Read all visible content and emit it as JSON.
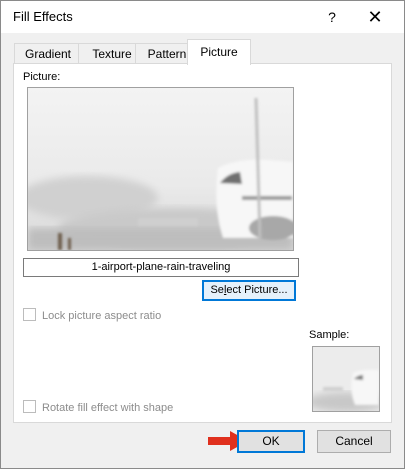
{
  "window": {
    "title": "Fill Effects",
    "help_label": "?",
    "close_label": "✕"
  },
  "tabs": [
    {
      "label": "Gradient",
      "active": false
    },
    {
      "label": "Texture",
      "active": false
    },
    {
      "label": "Pattern",
      "active": false
    },
    {
      "label": "Picture",
      "active": true
    }
  ],
  "picture": {
    "label": "Picture:",
    "name": "1-airport-plane-rain-traveling",
    "select_button": "Select Picture...",
    "select_mnemonic": "l"
  },
  "options": {
    "lock_aspect": {
      "label": "Lock picture aspect ratio",
      "checked": false,
      "enabled": false
    },
    "rotate_fill": {
      "label": "Rotate fill effect with shape",
      "checked": false,
      "enabled": false
    }
  },
  "sample": {
    "label": "Sample:"
  },
  "footer": {
    "ok_label": "OK",
    "cancel_label": "Cancel"
  },
  "colors": {
    "accent": "#0078d7",
    "arrow": "#e0301e"
  }
}
